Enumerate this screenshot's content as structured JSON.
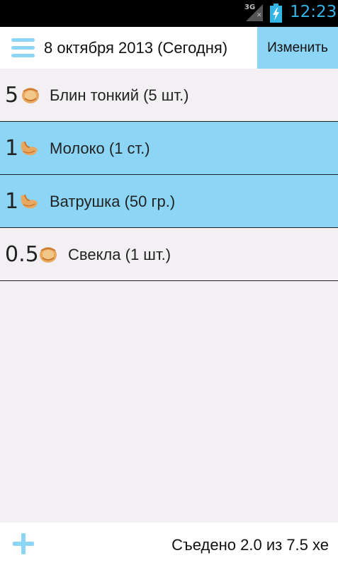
{
  "status_bar": {
    "network": "3G",
    "time": "12:23"
  },
  "header": {
    "date_title": "8 октября 2013 (Сегодня)",
    "edit_label": "Изменить"
  },
  "items": [
    {
      "qty": "5",
      "name": "Блин тонкий (5 шт.)",
      "icon": "pancake-icon",
      "highlighted": false
    },
    {
      "qty": "1",
      "name": "Молоко (1 ст.)",
      "icon": "bread-roll-icon",
      "highlighted": true
    },
    {
      "qty": "1",
      "name": "Ватрушка (50 гр.)",
      "icon": "bread-roll-icon",
      "highlighted": true
    },
    {
      "qty": "0.5",
      "name": "Свекла (1 шт.)",
      "icon": "pancake-icon",
      "highlighted": false
    }
  ],
  "footer": {
    "eaten_text": "Съедено 2.0 из 7.5 хе"
  },
  "colors": {
    "accent": "#8dd5f5",
    "clock": "#33b5e5",
    "list_bg": "#f3f0f3"
  }
}
